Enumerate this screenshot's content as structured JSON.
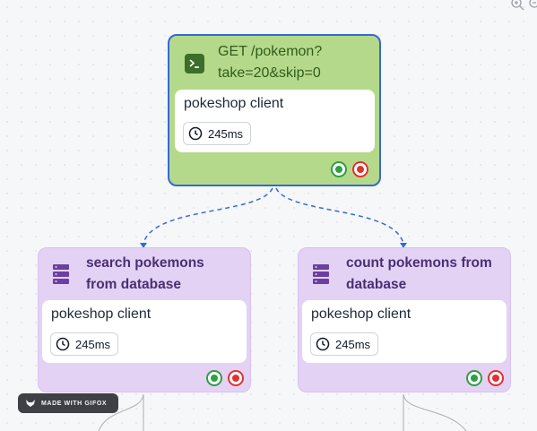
{
  "root": {
    "title": "GET /pokemon?take=20&skip=0",
    "client": "pokeshop client",
    "duration": "245ms"
  },
  "children": [
    {
      "title": "search pokemons from database",
      "client": "pokeshop client",
      "duration": "245ms"
    },
    {
      "title": "count pokemons from database",
      "client": "pokeshop client",
      "duration": "245ms"
    }
  ],
  "badge": {
    "label": "MADE WITH GIFOX"
  },
  "colors": {
    "root_fill": "#b5d98a",
    "root_border": "#3767d8",
    "child_fill": "#e4d2f5",
    "edge": "#3767d8",
    "ok": "#2f9e44",
    "error": "#e03131"
  },
  "icons": {
    "root": "terminal-icon",
    "child": "database-icon",
    "duration": "clock-icon",
    "status_ok": "check-status-icon",
    "status_err": "error-status-icon"
  }
}
